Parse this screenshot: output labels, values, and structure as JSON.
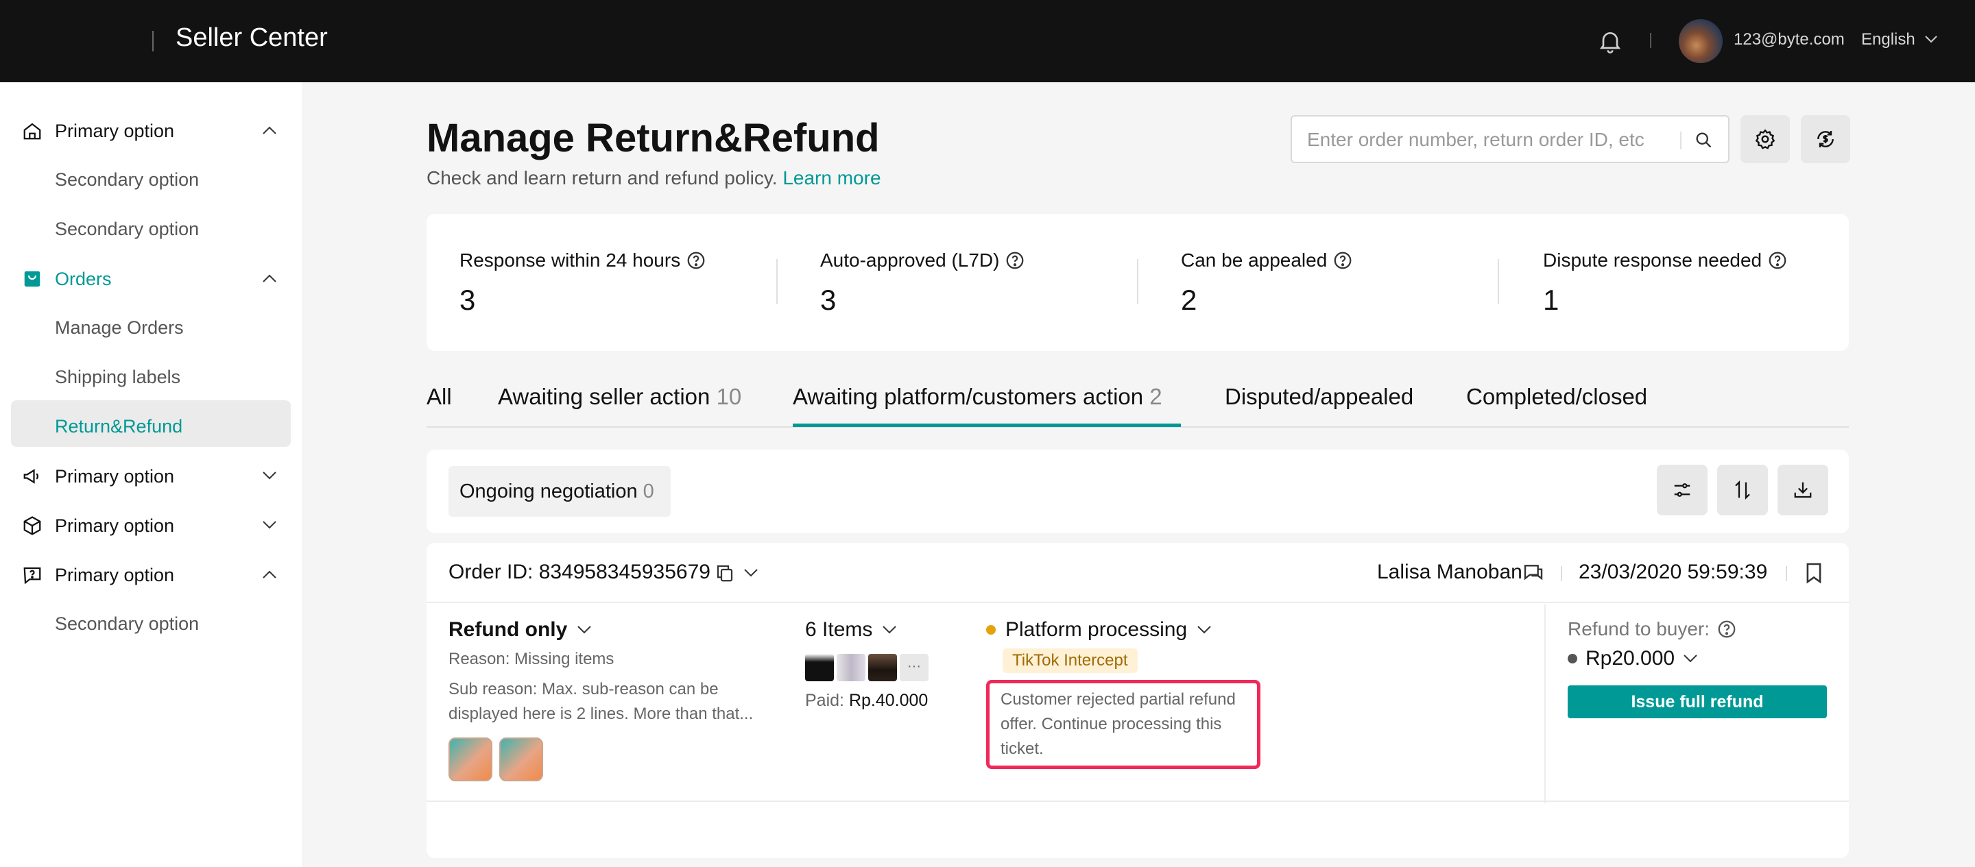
{
  "app": {
    "title": "Seller Center"
  },
  "topbar": {
    "email": "123@byte.com",
    "language": "English"
  },
  "sidebar": {
    "items": [
      {
        "label": "Primary option"
      },
      {
        "label": "Secondary option"
      },
      {
        "label": "Secondary option"
      },
      {
        "label": "Orders"
      },
      {
        "label": "Manage Orders"
      },
      {
        "label": "Shipping labels"
      },
      {
        "label": "Return&Refund"
      },
      {
        "label": "Primary option"
      },
      {
        "label": "Primary option"
      },
      {
        "label": "Primary option"
      },
      {
        "label": "Secondary option"
      }
    ]
  },
  "page": {
    "title": "Manage Return&Refund",
    "subtitle": "Check and learn return and refund policy.",
    "learn_more": "Learn more"
  },
  "search": {
    "placeholder": "Enter order number, return order ID, etc"
  },
  "stats": [
    {
      "label": "Response within 24 hours",
      "value": "3"
    },
    {
      "label": "Auto-approved (L7D)",
      "value": "3"
    },
    {
      "label": "Can be appealed",
      "value": "2"
    },
    {
      "label": "Dispute response needed",
      "value": "1"
    }
  ],
  "tabs": [
    {
      "label": "All",
      "count": ""
    },
    {
      "label": "Awaiting seller action",
      "count": "10"
    },
    {
      "label": "Awaiting platform/customers action",
      "count": "2"
    },
    {
      "label": "Disputed/appealed",
      "count": ""
    },
    {
      "label": "Completed/closed",
      "count": ""
    }
  ],
  "filter": {
    "chip_label": "Ongoing negotiation",
    "chip_count": "0"
  },
  "order": {
    "id": "Order ID: 834958345935679",
    "buyer": "Lalisa Manoban",
    "date": "23/03/2020 59:59:39",
    "refund_type": "Refund only",
    "reason": "Reason: Missing items",
    "sub_reason": "Sub reason: Max. sub-reason can be displayed here is 2 lines. More than that...",
    "items": "6 Items",
    "more": "···",
    "paid_label": "Paid:",
    "paid_amount": "Rp.40.000",
    "status": "Platform processing",
    "tag": "TikTok Intercept",
    "note": "Customer rejected partial refund offer. Continue processing this ticket.",
    "refund_label": "Refund to buyer:",
    "refund_amount": "Rp20.000",
    "action": "Issue full refund"
  }
}
